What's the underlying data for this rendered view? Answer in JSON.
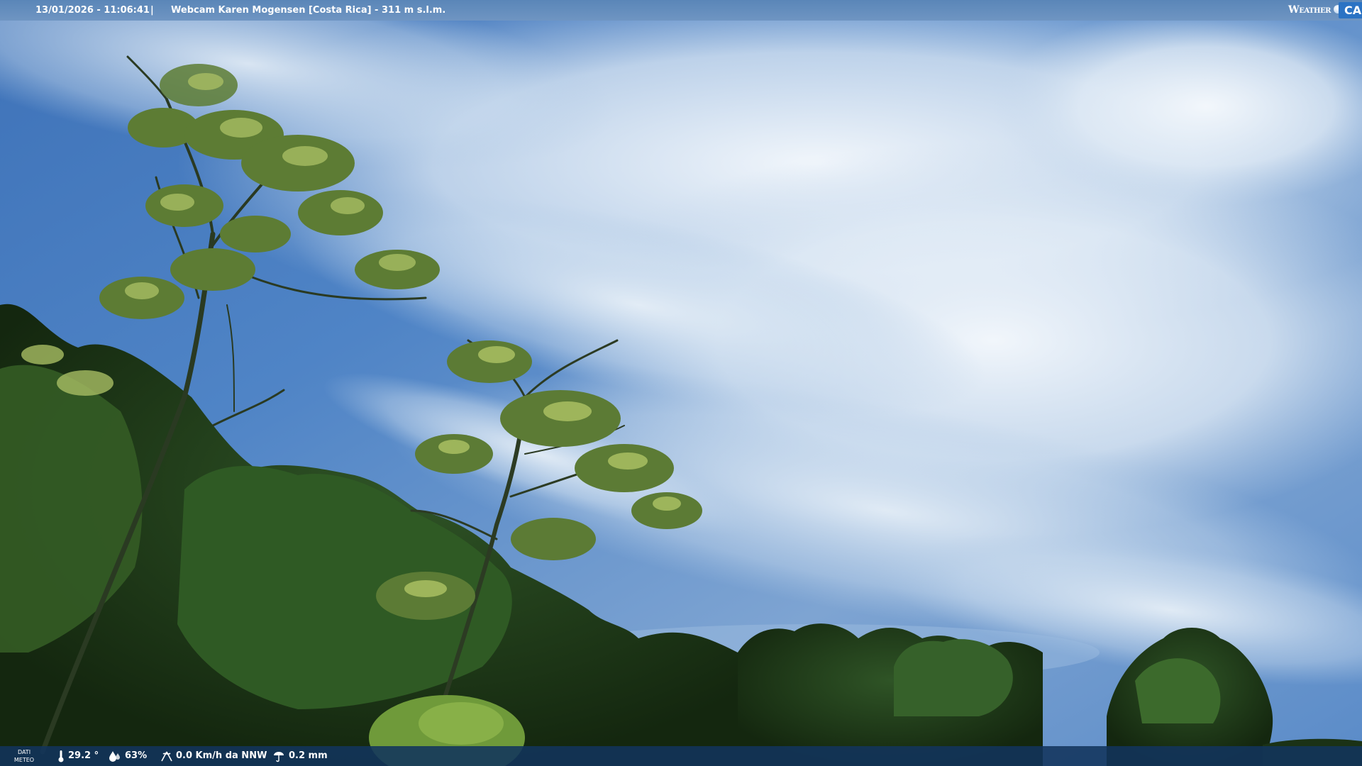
{
  "overlay": {
    "datetime": "13/01/2026 - 11:06:41",
    "separator": "|",
    "title": "Webcam Karen Mogensen [Costa Rica]  - 311 m s.l.m.",
    "logo": {
      "word": "Weather",
      "badge": "CAM",
      "colors": {
        "badge": "#2b73c4",
        "text": "#ffffff"
      }
    }
  },
  "weather_bar": {
    "label_line1": "DATI",
    "label_line2": "METEO",
    "temperature": "29.2 °",
    "humidity": "63%",
    "wind": "0.0 Km/h da NNW",
    "rain": "0.2 mm",
    "icons": [
      "thermometer-icon",
      "humidity-drop-icon",
      "wind-icon",
      "rain-icon"
    ]
  },
  "scene": {
    "description_icons": "sky-background",
    "colors": {
      "sky_top": "#6f9fd6",
      "sky_deep": "#2e62ad",
      "cloud": "#eef4fa",
      "foliage_dark": "#1c3418",
      "foliage_mid": "#3f6b2a",
      "foliage_light": "#9fbe5a"
    }
  }
}
